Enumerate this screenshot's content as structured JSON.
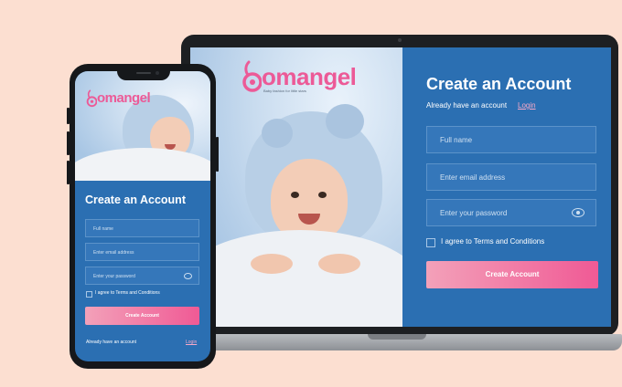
{
  "brand": {
    "name_b": "b",
    "name_rest": "omangel",
    "tagline": "Baby fashion for little stars",
    "accent_color": "#ec5a97",
    "primary_color": "#2b6fb2"
  },
  "form": {
    "title": "Create an Account",
    "already_text": "Already have an account",
    "login_link": "Login",
    "fullname_placeholder": "Full name",
    "email_placeholder": "Enter email address",
    "password_placeholder": "Enter your password",
    "agree_text": "I agree to Terms and Conditions",
    "submit_label": "Create Account",
    "password_icon": "eye-icon"
  }
}
